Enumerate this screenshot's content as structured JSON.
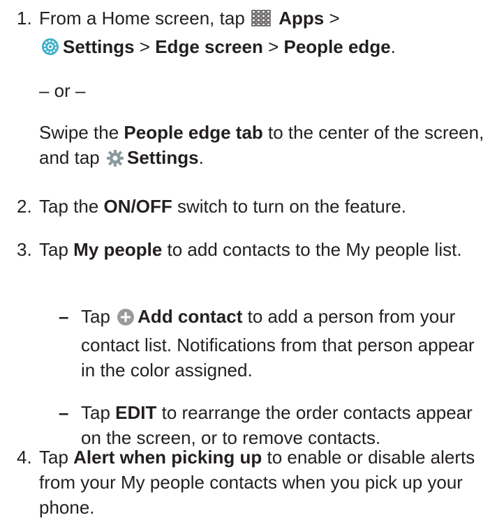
{
  "step1": {
    "num": "1.",
    "l1_pre": "From a Home screen, tap",
    "apps_icon": "apps-grid-icon",
    "apps": "Apps",
    "gt1": " >",
    "settings_icon": "settings-gear-icon",
    "settings": "Settings",
    "gt2": " > ",
    "edge": "Edge screen",
    "gt3": " > ",
    "people_edge": "People edge",
    "end": ".",
    "or": "– or –",
    "swipe_pre": "Swipe the ",
    "swipe_bold": "People edge tab",
    "swipe_mid": " to the center of the screen, and tap",
    "settings2_icon": "settings-gear-icon",
    "settings2": "Settings",
    "end2": "."
  },
  "step2": {
    "num": "2.",
    "pre": "Tap the ",
    "bold": "ON/OFF",
    "post": " switch to turn on the feature."
  },
  "step3": {
    "num": "3.",
    "pre": "Tap ",
    "bold": "My people",
    "post": " to add contacts to the My people list.",
    "sub1": {
      "dash": "–",
      "pre": "Tap",
      "icon": "add-circle-icon",
      "bold": "Add contact",
      "post": " to add a person from your contact list. Notifications from that person appear in the color assigned."
    },
    "sub2": {
      "dash": "–",
      "pre": "Tap ",
      "bold": "EDIT",
      "post": " to rearrange the order contacts appear on the screen, or to remove contacts."
    }
  },
  "step4": {
    "num": "4.",
    "pre": "Tap ",
    "bold": "Alert when picking up",
    "post": " to enable or disable alerts from your My people contacts when you pick up your phone."
  },
  "colors": {
    "text": "#231f20",
    "settings_icon_teal": "#3fb0c9",
    "gear_grey": "#8a9a9e",
    "add_icon_grey": "#9a9a9a"
  }
}
